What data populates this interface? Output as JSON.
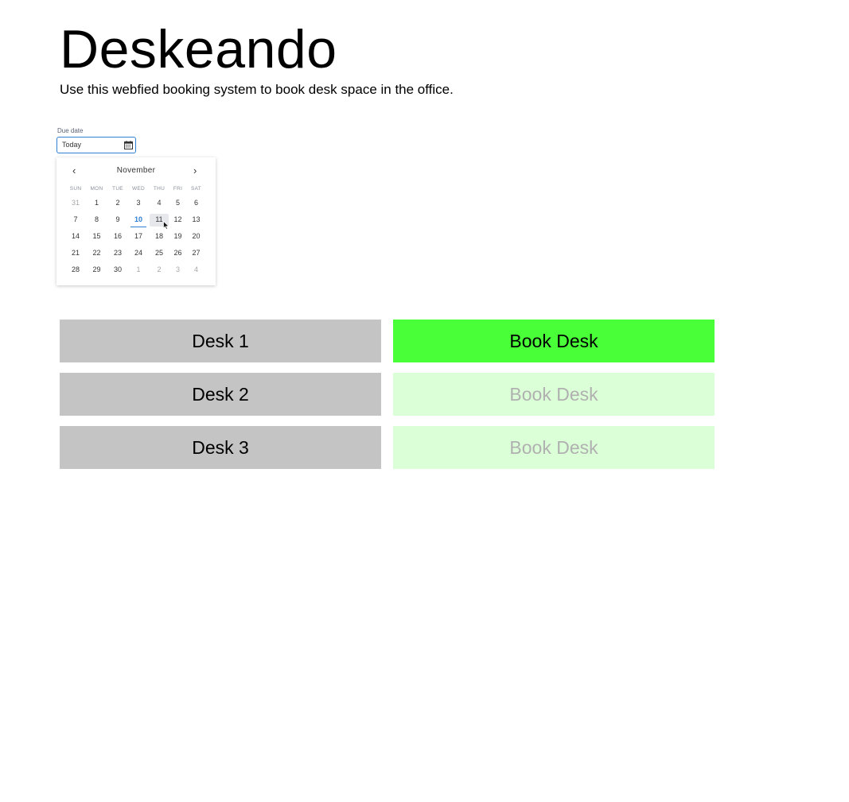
{
  "header": {
    "title": "Deskeando",
    "subtitle": "Use this webfied booking system to book desk space in the office."
  },
  "date_picker": {
    "label": "Due date",
    "value": "Today",
    "icon": "calendar-icon",
    "accent_color": "#2f7fd4",
    "calendar": {
      "month": "November",
      "prev_label": "‹",
      "next_label": "›",
      "weekdays": [
        "SUN",
        "MON",
        "TUE",
        "WED",
        "THU",
        "FRI",
        "SAT"
      ],
      "weeks": [
        [
          {
            "d": "31",
            "muted": true
          },
          {
            "d": "1"
          },
          {
            "d": "2"
          },
          {
            "d": "3"
          },
          {
            "d": "4"
          },
          {
            "d": "5"
          },
          {
            "d": "6"
          }
        ],
        [
          {
            "d": "7"
          },
          {
            "d": "8"
          },
          {
            "d": "9"
          },
          {
            "d": "10",
            "today": true
          },
          {
            "d": "11",
            "hover": true
          },
          {
            "d": "12"
          },
          {
            "d": "13"
          }
        ],
        [
          {
            "d": "14"
          },
          {
            "d": "15"
          },
          {
            "d": "16"
          },
          {
            "d": "17"
          },
          {
            "d": "18"
          },
          {
            "d": "19"
          },
          {
            "d": "20"
          }
        ],
        [
          {
            "d": "21"
          },
          {
            "d": "22"
          },
          {
            "d": "23"
          },
          {
            "d": "24"
          },
          {
            "d": "25"
          },
          {
            "d": "26"
          },
          {
            "d": "27"
          }
        ],
        [
          {
            "d": "28"
          },
          {
            "d": "29"
          },
          {
            "d": "30"
          },
          {
            "d": "1",
            "muted": true
          },
          {
            "d": "2",
            "muted": true
          },
          {
            "d": "3",
            "muted": true
          },
          {
            "d": "4",
            "muted": true
          }
        ]
      ]
    }
  },
  "desks": [
    {
      "name": "Desk 1",
      "button_label": "Book Desk",
      "enabled": true
    },
    {
      "name": "Desk 2",
      "button_label": "Book Desk",
      "enabled": false
    },
    {
      "name": "Desk 3",
      "button_label": "Book Desk",
      "enabled": false
    }
  ],
  "colors": {
    "desk_label_bg": "#c4c4c4",
    "book_active_bg": "#48ff38",
    "book_disabled_bg": "#dbffd7",
    "book_disabled_text": "#b0b0b0"
  }
}
